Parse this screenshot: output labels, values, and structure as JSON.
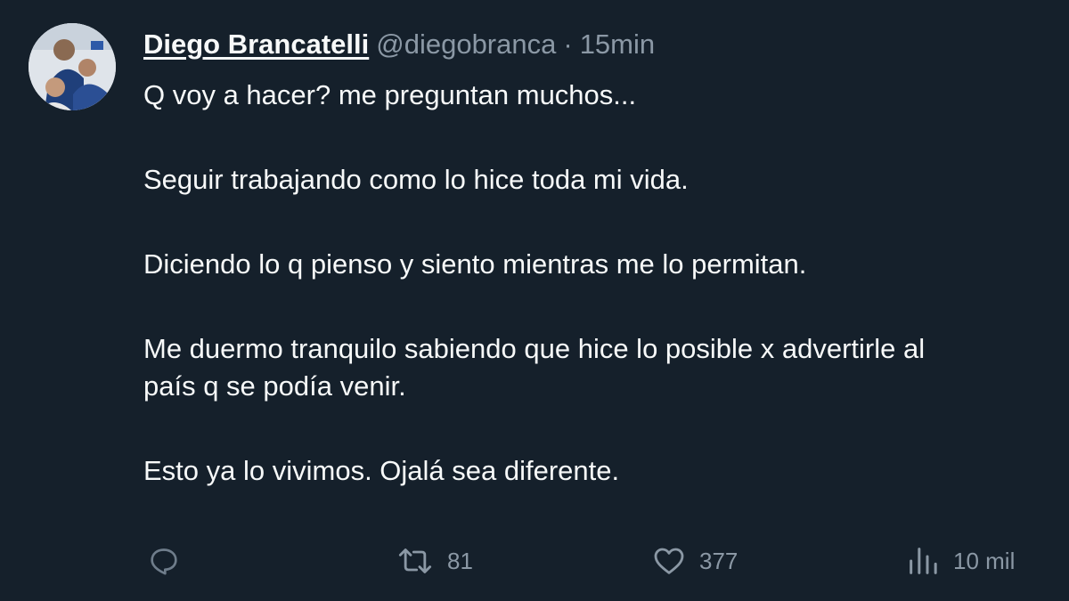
{
  "author": {
    "name": "Diego Brancatelli",
    "handle": "@diegobranca",
    "separator": "·",
    "time": "15min"
  },
  "tweet": {
    "lines": [
      "Q voy a hacer? me preguntan muchos...",
      "Seguir trabajando como lo hice toda mi vida.",
      "Diciendo lo q pienso y siento mientras me lo permitan.",
      "Me duermo tranquilo sabiendo que hice lo posible x advertirle al",
      "país q se podía venir.",
      "Esto ya lo vivimos. Ojalá sea diferente."
    ]
  },
  "actions": {
    "reply": {
      "icon": "reply-icon",
      "count": ""
    },
    "retweet": {
      "icon": "retweet-icon",
      "count": "81"
    },
    "like": {
      "icon": "heart-icon",
      "count": "377"
    },
    "views": {
      "icon": "views-icon",
      "count": "10 mil"
    }
  },
  "colors": {
    "background": "#15202b",
    "text": "#f7f9f9",
    "muted": "#8b98a5"
  }
}
